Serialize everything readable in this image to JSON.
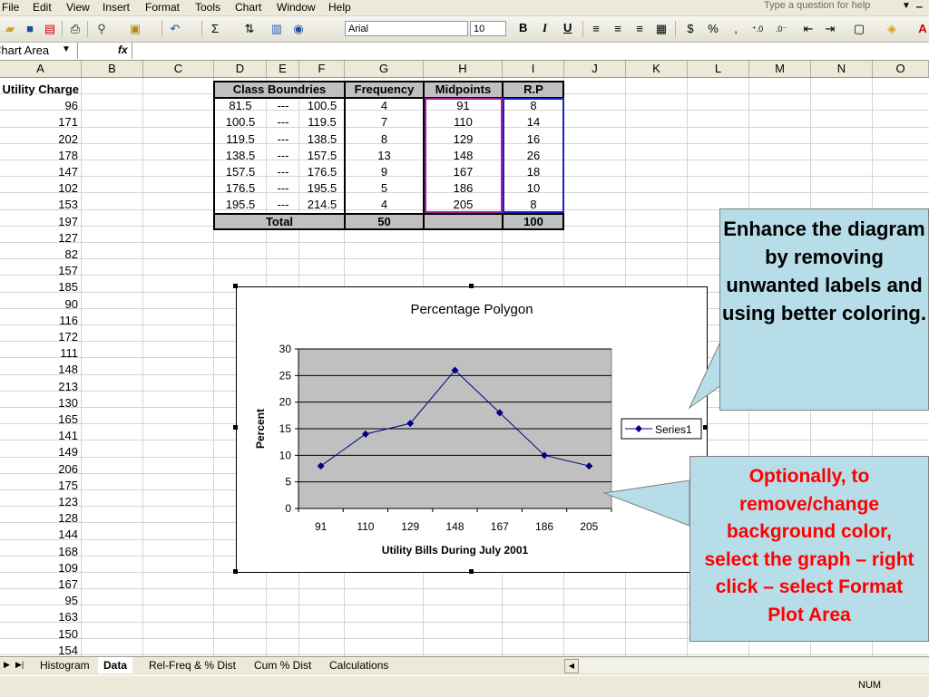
{
  "menu": {
    "items": [
      "File",
      "Edit",
      "View",
      "Insert",
      "Format",
      "Tools",
      "Chart",
      "Window",
      "Help"
    ],
    "help_placeholder": "Type a question for help"
  },
  "toolbar": {
    "font_name": "Arial",
    "font_size": "10",
    "bold": "B",
    "italic": "I",
    "underline": "U",
    "sigma": "Σ",
    "currency": "$",
    "percent": "%"
  },
  "formula_bar": {
    "name_box": "Chart Area",
    "fx": "fx"
  },
  "columns": [
    "A",
    "B",
    "C",
    "D",
    "E",
    "F",
    "G",
    "H",
    "I",
    "J",
    "K",
    "L",
    "M",
    "N",
    "O"
  ],
  "column_a": {
    "header": "Utility Charge",
    "values": [
      "96",
      "171",
      "202",
      "178",
      "147",
      "102",
      "153",
      "197",
      "127",
      "82",
      "157",
      "185",
      "90",
      "116",
      "172",
      "111",
      "148",
      "213",
      "130",
      "165",
      "141",
      "149",
      "206",
      "175",
      "123",
      "128",
      "144",
      "168",
      "109",
      "167",
      "95",
      "163",
      "150",
      "154"
    ]
  },
  "table": {
    "headers": {
      "class_boundries": "Class Boundries",
      "frequency": "Frequency",
      "midpoints": "Midpoints",
      "rp": "R.P"
    },
    "rows": [
      {
        "lower": "81.5",
        "sep": "---",
        "upper": "100.5",
        "freq": "4",
        "mid": "91",
        "rp": "8"
      },
      {
        "lower": "100.5",
        "sep": "---",
        "upper": "119.5",
        "freq": "7",
        "mid": "110",
        "rp": "14"
      },
      {
        "lower": "119.5",
        "sep": "---",
        "upper": "138.5",
        "freq": "8",
        "mid": "129",
        "rp": "16"
      },
      {
        "lower": "138.5",
        "sep": "---",
        "upper": "157.5",
        "freq": "13",
        "mid": "148",
        "rp": "26"
      },
      {
        "lower": "157.5",
        "sep": "---",
        "upper": "176.5",
        "freq": "9",
        "mid": "167",
        "rp": "18"
      },
      {
        "lower": "176.5",
        "sep": "---",
        "upper": "195.5",
        "freq": "5",
        "mid": "186",
        "rp": "10"
      },
      {
        "lower": "195.5",
        "sep": "---",
        "upper": "214.5",
        "freq": "4",
        "mid": "205",
        "rp": "8"
      }
    ],
    "total_label": "Total",
    "total_freq": "50",
    "total_rp": "100"
  },
  "chart_data": {
    "type": "line",
    "title": "Percentage Polygon",
    "xlabel": "Utility Bills During July 2001",
    "ylabel": "Percent",
    "categories": [
      "91",
      "110",
      "129",
      "148",
      "167",
      "186",
      "205"
    ],
    "series": [
      {
        "name": "Series1",
        "values": [
          8,
          14,
          16,
          26,
          18,
          10,
          8
        ]
      }
    ],
    "ylim": [
      0,
      30
    ],
    "yticks": [
      0,
      5,
      10,
      15,
      20,
      25,
      30
    ],
    "grid": true,
    "legend": "right",
    "plot_background": "#c0c0c0",
    "line_color": "#000080"
  },
  "callouts": {
    "top": "Enhance the diagram by removing unwanted labels and using better coloring.",
    "bottom": "Optionally, to remove/change background color, select the graph – right click – select Format Plot Area",
    "top_color": "#000000",
    "bottom_color": "#ff0000",
    "fill": "#b7dde8"
  },
  "sheet_tabs": [
    "Histogram",
    "Data",
    "Rel-Freq & % Dist",
    "Cum % Dist",
    "Calculations"
  ],
  "active_tab": "Data",
  "status": {
    "num": "NUM"
  }
}
